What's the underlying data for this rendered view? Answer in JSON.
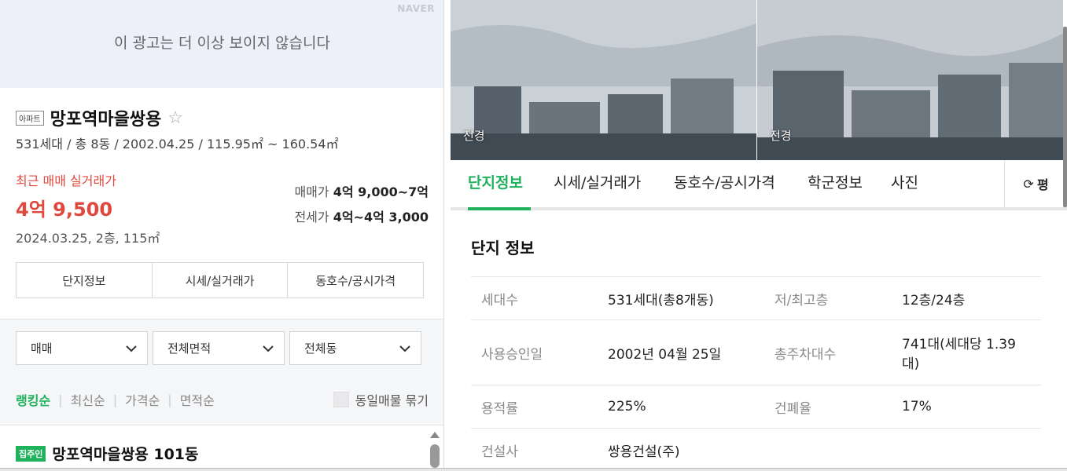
{
  "ad": {
    "brand": "NAVER",
    "message": "이 광고는 더 이상 보이지 않습니다"
  },
  "complex": {
    "type_badge": "아파트",
    "name": "망포역마을쌍용",
    "summary": "531세대 / 총 8동 / 2002.04.25 / 115.95㎡ ~ 160.54㎡"
  },
  "recent_trade": {
    "label": "최근 매매 실거래가",
    "price": "4억 9,500",
    "date_detail": "2024.03.25, 2층, 115㎡",
    "sale_label": "매매가",
    "sale_range": "4억 9,000~7억",
    "jeonse_label": "전세가",
    "jeonse_range": "4억~4억 3,000"
  },
  "left_tabs": [
    "단지정보",
    "시세/실거래가",
    "동호수/공시가격"
  ],
  "filters": {
    "trade_type": "매매",
    "area": "전체면적",
    "dong": "전체동"
  },
  "sort": {
    "options": [
      "랭킹순",
      "최신순",
      "가격순",
      "면적순"
    ],
    "active": "랭킹순",
    "group_label": "동일매물 묶기"
  },
  "listing": {
    "badge": "집주인",
    "title": "망포역마을쌍용 101동"
  },
  "photos": [
    {
      "caption": "전경"
    },
    {
      "caption": "전경"
    }
  ],
  "right_tabs": [
    "단지정보",
    "시세/실거래가",
    "동호수/공시가격",
    "학군정보",
    "사진"
  ],
  "area_toggle": "평",
  "info": {
    "title": "단지 정보",
    "rows": [
      {
        "k1": "세대수",
        "v1": "531세대(총8개동)",
        "k2": "저/최고층",
        "v2": "12층/24층"
      },
      {
        "k1": "사용승인일",
        "v1": "2002년 04월 25일",
        "k2": "총주차대수",
        "v2": "741대(세대당 1.39대)"
      },
      {
        "k1": "용적률",
        "v1": "225%",
        "k2": "건폐율",
        "v2": "17%"
      },
      {
        "k1": "건설사",
        "v1": "쌍용건설(주)",
        "k2": "",
        "v2": ""
      }
    ]
  },
  "colors": {
    "accent_green": "#1fb15b",
    "price_red": "#e0483e"
  }
}
